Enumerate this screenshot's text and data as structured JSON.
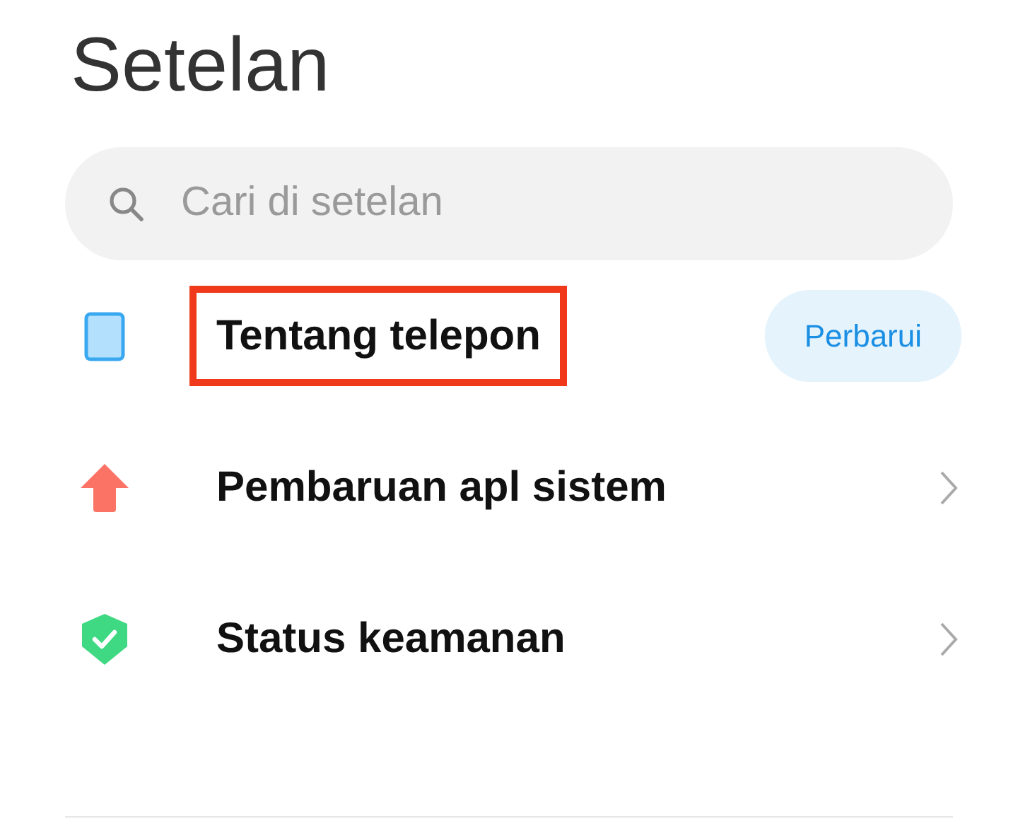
{
  "title": "Setelan",
  "search": {
    "placeholder": "Cari di setelan"
  },
  "items": [
    {
      "label": "Tentang telepon",
      "highlighted": true,
      "kind": "button",
      "action": "Perbarui"
    },
    {
      "label": "Pembaruan apl sistem",
      "highlighted": false,
      "kind": "chevron"
    },
    {
      "label": "Status keamanan",
      "highlighted": false,
      "kind": "chevron"
    }
  ]
}
